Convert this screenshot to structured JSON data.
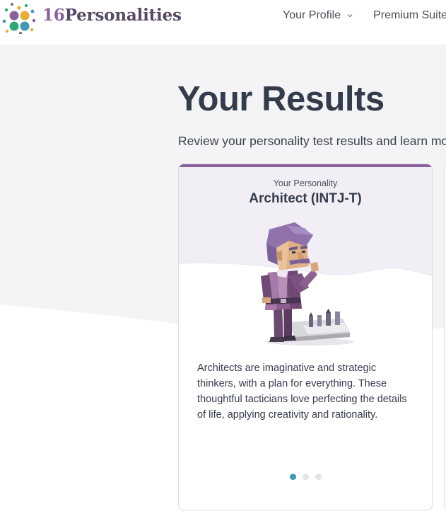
{
  "header": {
    "logo_number": "16",
    "logo_word": "Personalities",
    "nav": [
      {
        "label": "Your Profile",
        "has_dropdown": true
      },
      {
        "label": "Premium Suite",
        "has_dropdown": false
      }
    ]
  },
  "main": {
    "title": "Your Results",
    "subtitle": "Review your personality test results and learn more about yourself"
  },
  "card": {
    "label": "Your Personality",
    "type": "Architect (INTJ-T)",
    "description": "Architects are imaginative and strategic thinkers, with a plan for everything. These thoughtful tacticians love perfecting the details of life, applying creativity and rationality.",
    "illustration": "architect-character-icon",
    "pager": {
      "count": 3,
      "active": 1
    }
  },
  "colors": {
    "brand_purple": "#88619a",
    "text_dark": "#343c4b",
    "pager_active": "#4298b4",
    "background": "#f4f4f6"
  }
}
